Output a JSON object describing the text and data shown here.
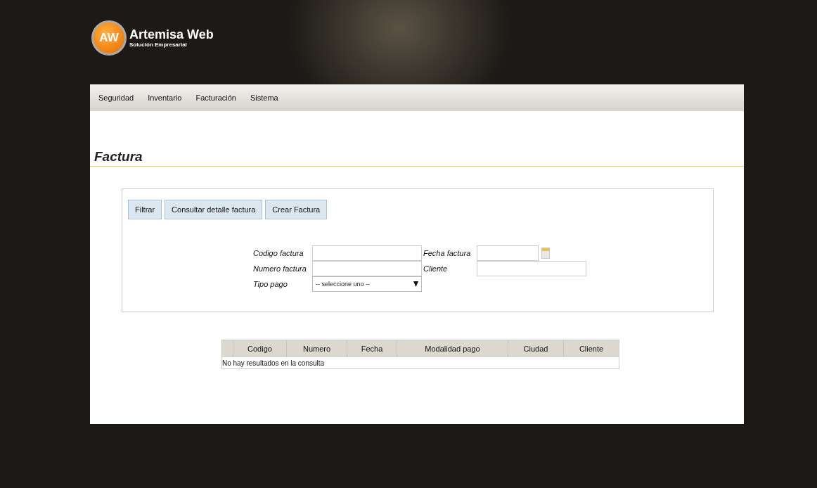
{
  "logo": {
    "badge": "AW",
    "name": "Artemisa Web",
    "tagline": "Solución Empresarial"
  },
  "menu": [
    {
      "label": "Seguridad"
    },
    {
      "label": "Inventario"
    },
    {
      "label": "Facturación"
    },
    {
      "label": "Sistema"
    }
  ],
  "page_title": "Factura",
  "buttons": [
    "Filtrar",
    "Consultar detalle factura",
    "Crear Factura"
  ],
  "filters": [
    {
      "label": "Codigo factura",
      "kind": "text"
    },
    {
      "label": "Fecha factura",
      "kind": "date"
    },
    {
      "label": "Numero factura",
      "kind": "text"
    },
    {
      "label": "Cliente",
      "kind": "text"
    },
    {
      "label": "Tipo pago",
      "kind": "select",
      "value": "-- seleccione uno --"
    }
  ],
  "table": {
    "columns": [
      "Codigo",
      "Numero",
      "Fecha",
      "Modalidad pago",
      "Ciudad",
      "Cliente"
    ],
    "empty_message": "No hay resultados en la consulta"
  }
}
